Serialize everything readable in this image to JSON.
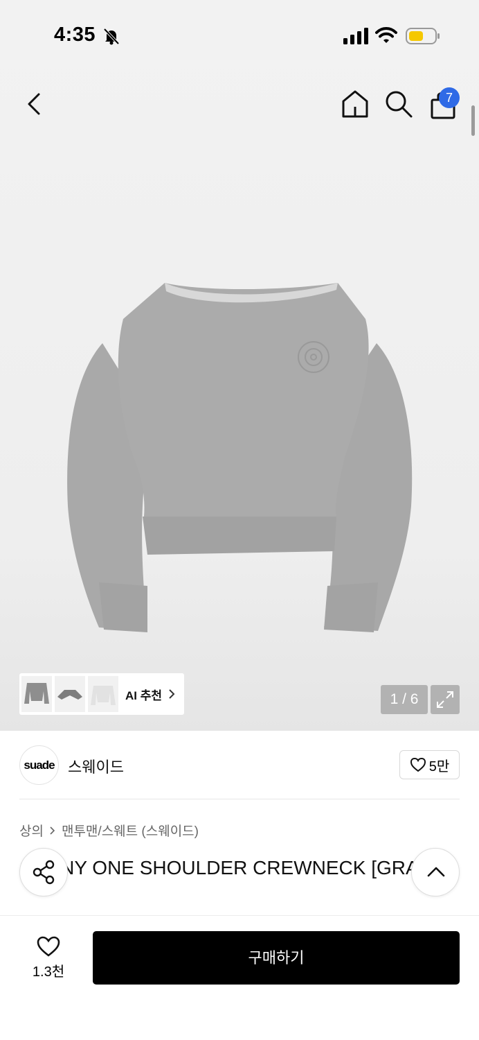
{
  "status_bar": {
    "time": "4:35"
  },
  "nav": {
    "cart_count": "7"
  },
  "gallery": {
    "page_current": 1,
    "page_total": 6,
    "page_label": "1 / 6",
    "ai_recommend_label": "AI 추천"
  },
  "brand": {
    "logo_text": "suade",
    "name": "스웨이드",
    "likes": "5만"
  },
  "breadcrumb": {
    "level1": "상의",
    "level2": "맨투맨/스웨트 (스웨이드)"
  },
  "product": {
    "title": "SUNNY ONE SHOULDER CREWNECK [GRAY]"
  },
  "bottom_bar": {
    "wish_count": "1.3천",
    "buy_label": "구매하기"
  },
  "colors": {
    "badge": "#2f6ae6",
    "buy_button": "#000000",
    "battery": "#f5c800"
  },
  "icons": [
    "bell-off-icon",
    "signal-icon",
    "wifi-icon",
    "battery-icon",
    "back-icon",
    "home-icon",
    "search-icon",
    "shopping-bag-icon",
    "expand-icon",
    "heart-icon",
    "share-icon",
    "chevron-up-icon",
    "chevron-right-icon"
  ]
}
